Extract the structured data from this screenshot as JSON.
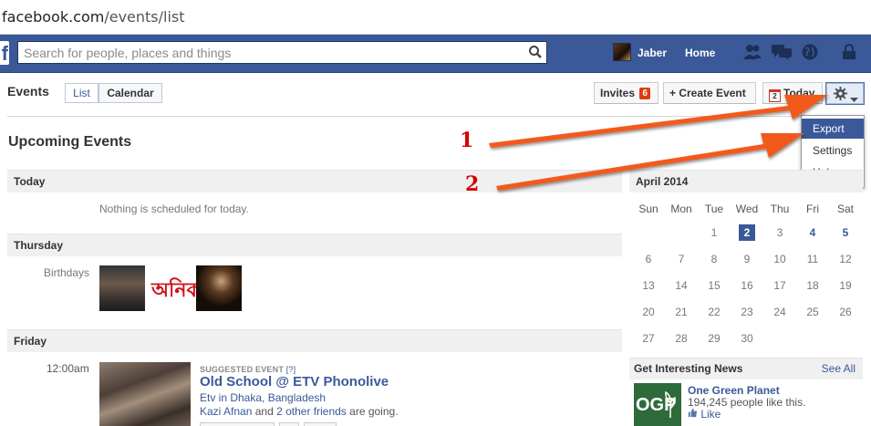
{
  "browser": {
    "url_host": "facebook.com",
    "url_path": "/events/list"
  },
  "topbar": {
    "logo": "f",
    "search_placeholder": "Search for people, places and things",
    "user_name": "Jaber",
    "home_label": "Home"
  },
  "events_header": {
    "title": "Events",
    "view_list": "List",
    "view_calendar": "Calendar",
    "invites_label": "Invites",
    "invites_count": "6",
    "create_label": "+ Create Event",
    "today_label": "Today",
    "today_date": "2"
  },
  "gear_menu": {
    "items": [
      "Export",
      "Settings",
      "Help"
    ],
    "highlighted": "Export"
  },
  "annotations": [
    "1",
    "2"
  ],
  "upcoming": {
    "title": "Upcoming Events",
    "sections": [
      {
        "label": "Today",
        "empty_text": "Nothing is scheduled for today."
      },
      {
        "label": "Thursday",
        "row_label": "Birthdays",
        "name_text": "অনিক"
      },
      {
        "label": "Friday"
      }
    ],
    "event": {
      "time": "12:00am",
      "suggested": "SUGGESTED EVENT",
      "help_mark": "[?]",
      "title": "Old School @ ETV Phonolive",
      "location": "Etv in Dhaka, Bangladesh",
      "friend": "Kazi Afnan",
      "and_text": "and",
      "others": "2 other friends",
      "going": "are going."
    }
  },
  "calendar": {
    "month": "April 2014",
    "weekdays": [
      "Sun",
      "Mon",
      "Tue",
      "Wed",
      "Thu",
      "Fri",
      "Sat"
    ],
    "weeks": [
      [
        "",
        "",
        "1",
        "2",
        "3",
        "4",
        "5"
      ],
      [
        "6",
        "7",
        "8",
        "9",
        "10",
        "11",
        "12"
      ],
      [
        "13",
        "14",
        "15",
        "16",
        "17",
        "18",
        "19"
      ],
      [
        "20",
        "21",
        "22",
        "23",
        "24",
        "25",
        "26"
      ],
      [
        "27",
        "28",
        "29",
        "30",
        "",
        "",
        ""
      ]
    ],
    "today": "2",
    "event_days": [
      "4",
      "5"
    ]
  },
  "news": {
    "title": "Get Interesting News",
    "see_all": "See All",
    "page_logo": "OGP",
    "page_name": "One Green Planet",
    "likes_text": "194,245 people like this.",
    "like_label": "Like"
  },
  "colors": {
    "brand": "#3b5998",
    "badge": "#dd3c10",
    "annotation": "#d40000",
    "arrow": "#f25a1c"
  }
}
